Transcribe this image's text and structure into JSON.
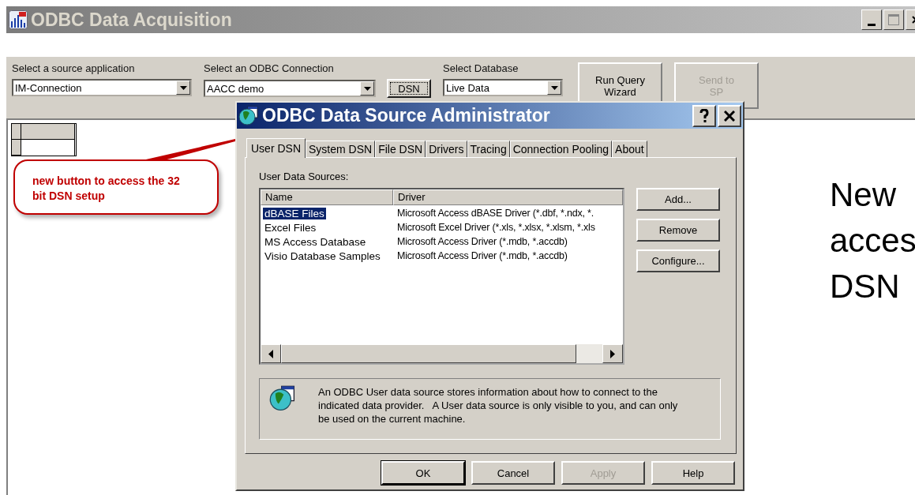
{
  "window": {
    "title": "ODBC Data Acquisition"
  },
  "toolbar": {
    "fields": [
      {
        "label": "Select a source application",
        "value": "IM-Connection"
      },
      {
        "label": "Select an ODBC Connection",
        "value": "AACC demo"
      },
      {
        "label": "Select Database",
        "value": "Live Data"
      }
    ],
    "dsn_button": "DSN",
    "buttons": [
      {
        "label": "Run Query Wizard",
        "disabled": false
      },
      {
        "label": "Send to SP",
        "disabled": true
      }
    ]
  },
  "dialog": {
    "title": "ODBC Data Source Administrator",
    "tabs": [
      {
        "label": "User DSN",
        "selected": true
      },
      {
        "label": "System DSN",
        "selected": false
      },
      {
        "label": "File DSN",
        "selected": false
      },
      {
        "label": "Drivers",
        "selected": false
      },
      {
        "label": "Tracing",
        "selected": false
      },
      {
        "label": "Connection Pooling",
        "selected": false
      },
      {
        "label": "About",
        "selected": false
      }
    ],
    "list_label": "User Data Sources:",
    "columns": [
      "Name",
      "Driver"
    ],
    "rows": [
      {
        "name": "dBASE Files",
        "driver": "Microsoft Access dBASE Driver (*.dbf, *.ndx, *.",
        "selected": true
      },
      {
        "name": "Excel Files",
        "driver": "Microsoft Excel Driver (*.xls, *.xlsx, *.xlsm, *.xls",
        "selected": false
      },
      {
        "name": "MS Access Database",
        "driver": "Microsoft Access Driver (*.mdb, *.accdb)",
        "selected": false
      },
      {
        "name": "Visio Database Samples",
        "driver": "Microsoft Access Driver (*.mdb, *.accdb)",
        "selected": false
      }
    ],
    "side_buttons": [
      "Add...",
      "Remove",
      "Configure..."
    ],
    "info": "An ODBC User data source stores information about how to connect to the indicated data provider.   A User data source is only visible to you, and can only be used on the current machine.",
    "buttons": [
      {
        "label": "OK",
        "disabled": false
      },
      {
        "label": "Cancel",
        "disabled": false
      },
      {
        "label": "Apply",
        "disabled": true
      },
      {
        "label": "Help",
        "disabled": false
      }
    ]
  },
  "callout": "new button to access the 32 bit DSN setup",
  "slide_text": [
    "New",
    "acces",
    "DSN"
  ]
}
